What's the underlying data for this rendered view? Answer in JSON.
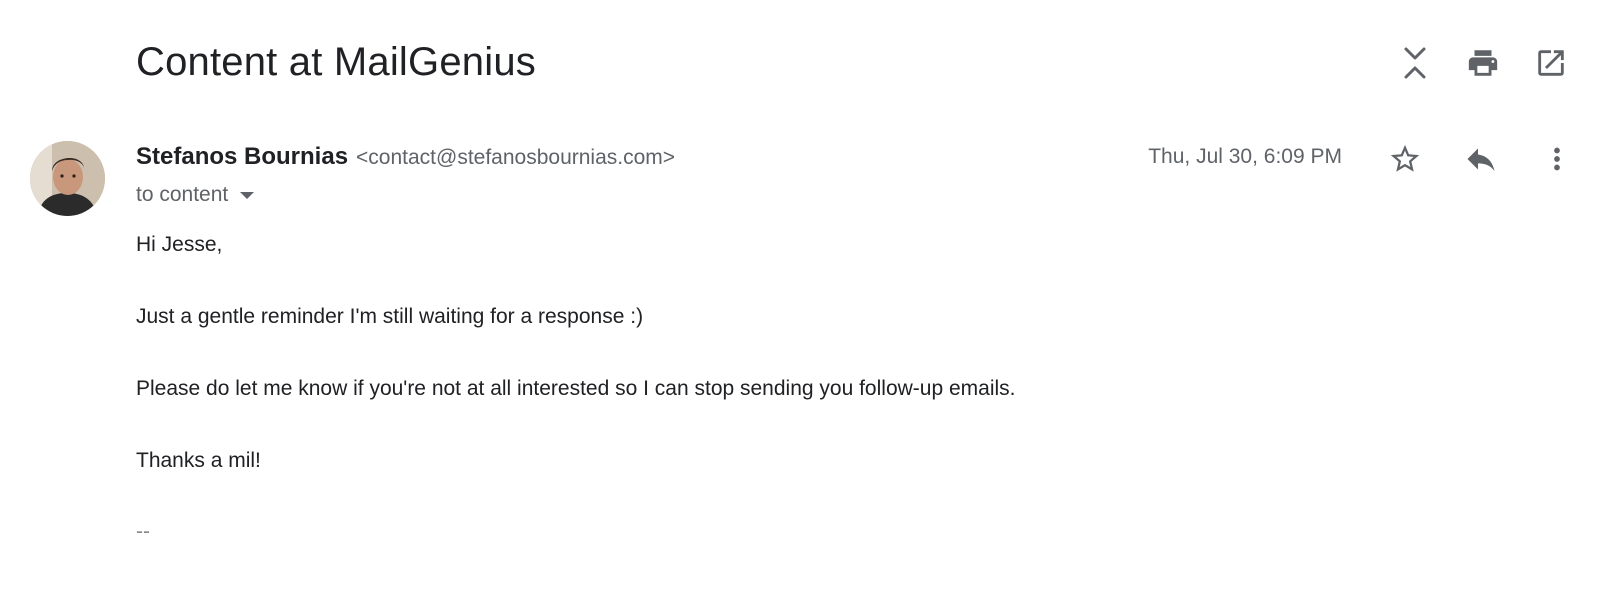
{
  "email": {
    "subject": "Content at MailGenius",
    "sender_name": "Stefanos Bournias",
    "sender_email": "<contact@stefanosbournias.com>",
    "recipient": "to content",
    "date": "Thu, Jul 30, 6:09 PM",
    "body": [
      "Hi Jesse,",
      "Just a gentle reminder I'm still waiting for a response :)",
      "Please do let me know if you're not at all interested so I can stop sending you follow-up emails.",
      "Thanks a mil!"
    ],
    "signature_separator": "--"
  },
  "toolbar": {
    "icons": [
      "collapse-all-icon",
      "print-icon",
      "open-in-new-window-icon"
    ]
  },
  "message_actions": {
    "icons": [
      "star-icon",
      "reply-icon",
      "more-vert-icon"
    ]
  },
  "colors": {
    "text_primary": "#202124",
    "text_secondary": "#5f6368",
    "icon": "#5f6368"
  }
}
